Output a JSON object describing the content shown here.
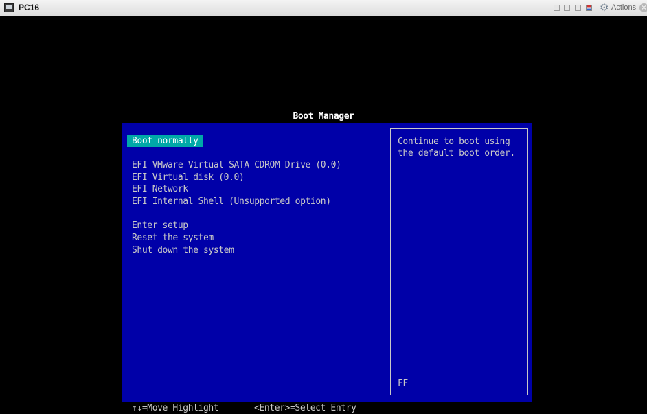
{
  "window": {
    "title": "PC16",
    "actions_label": "Actions"
  },
  "bios": {
    "title": "Boot Manager",
    "menu": [
      {
        "label": "Boot normally",
        "selected": true
      },
      {
        "label": "EFI VMware Virtual SATA CDROM Drive (0.0)"
      },
      {
        "label": "EFI Virtual disk (0.0)"
      },
      {
        "label": "EFI Network"
      },
      {
        "label": "EFI Internal Shell (Unsupported option)"
      },
      {
        "label": "Enter setup"
      },
      {
        "label": "Reset the system"
      },
      {
        "label": "Shut down the system"
      }
    ],
    "help_text": "Continue to boot using the default boot order.",
    "help_footer": "FF",
    "hints": {
      "move": "↑↓=Move Highlight",
      "select": "<Enter>=Select Entry"
    }
  },
  "colors": {
    "panel_bg": "#0000a8",
    "highlight_bg": "#00a8a8",
    "text": "#c8c8c8"
  },
  "icons": [
    "vm-monitor-icon",
    "gear-icon",
    "close-icon",
    "flag-icon"
  ]
}
